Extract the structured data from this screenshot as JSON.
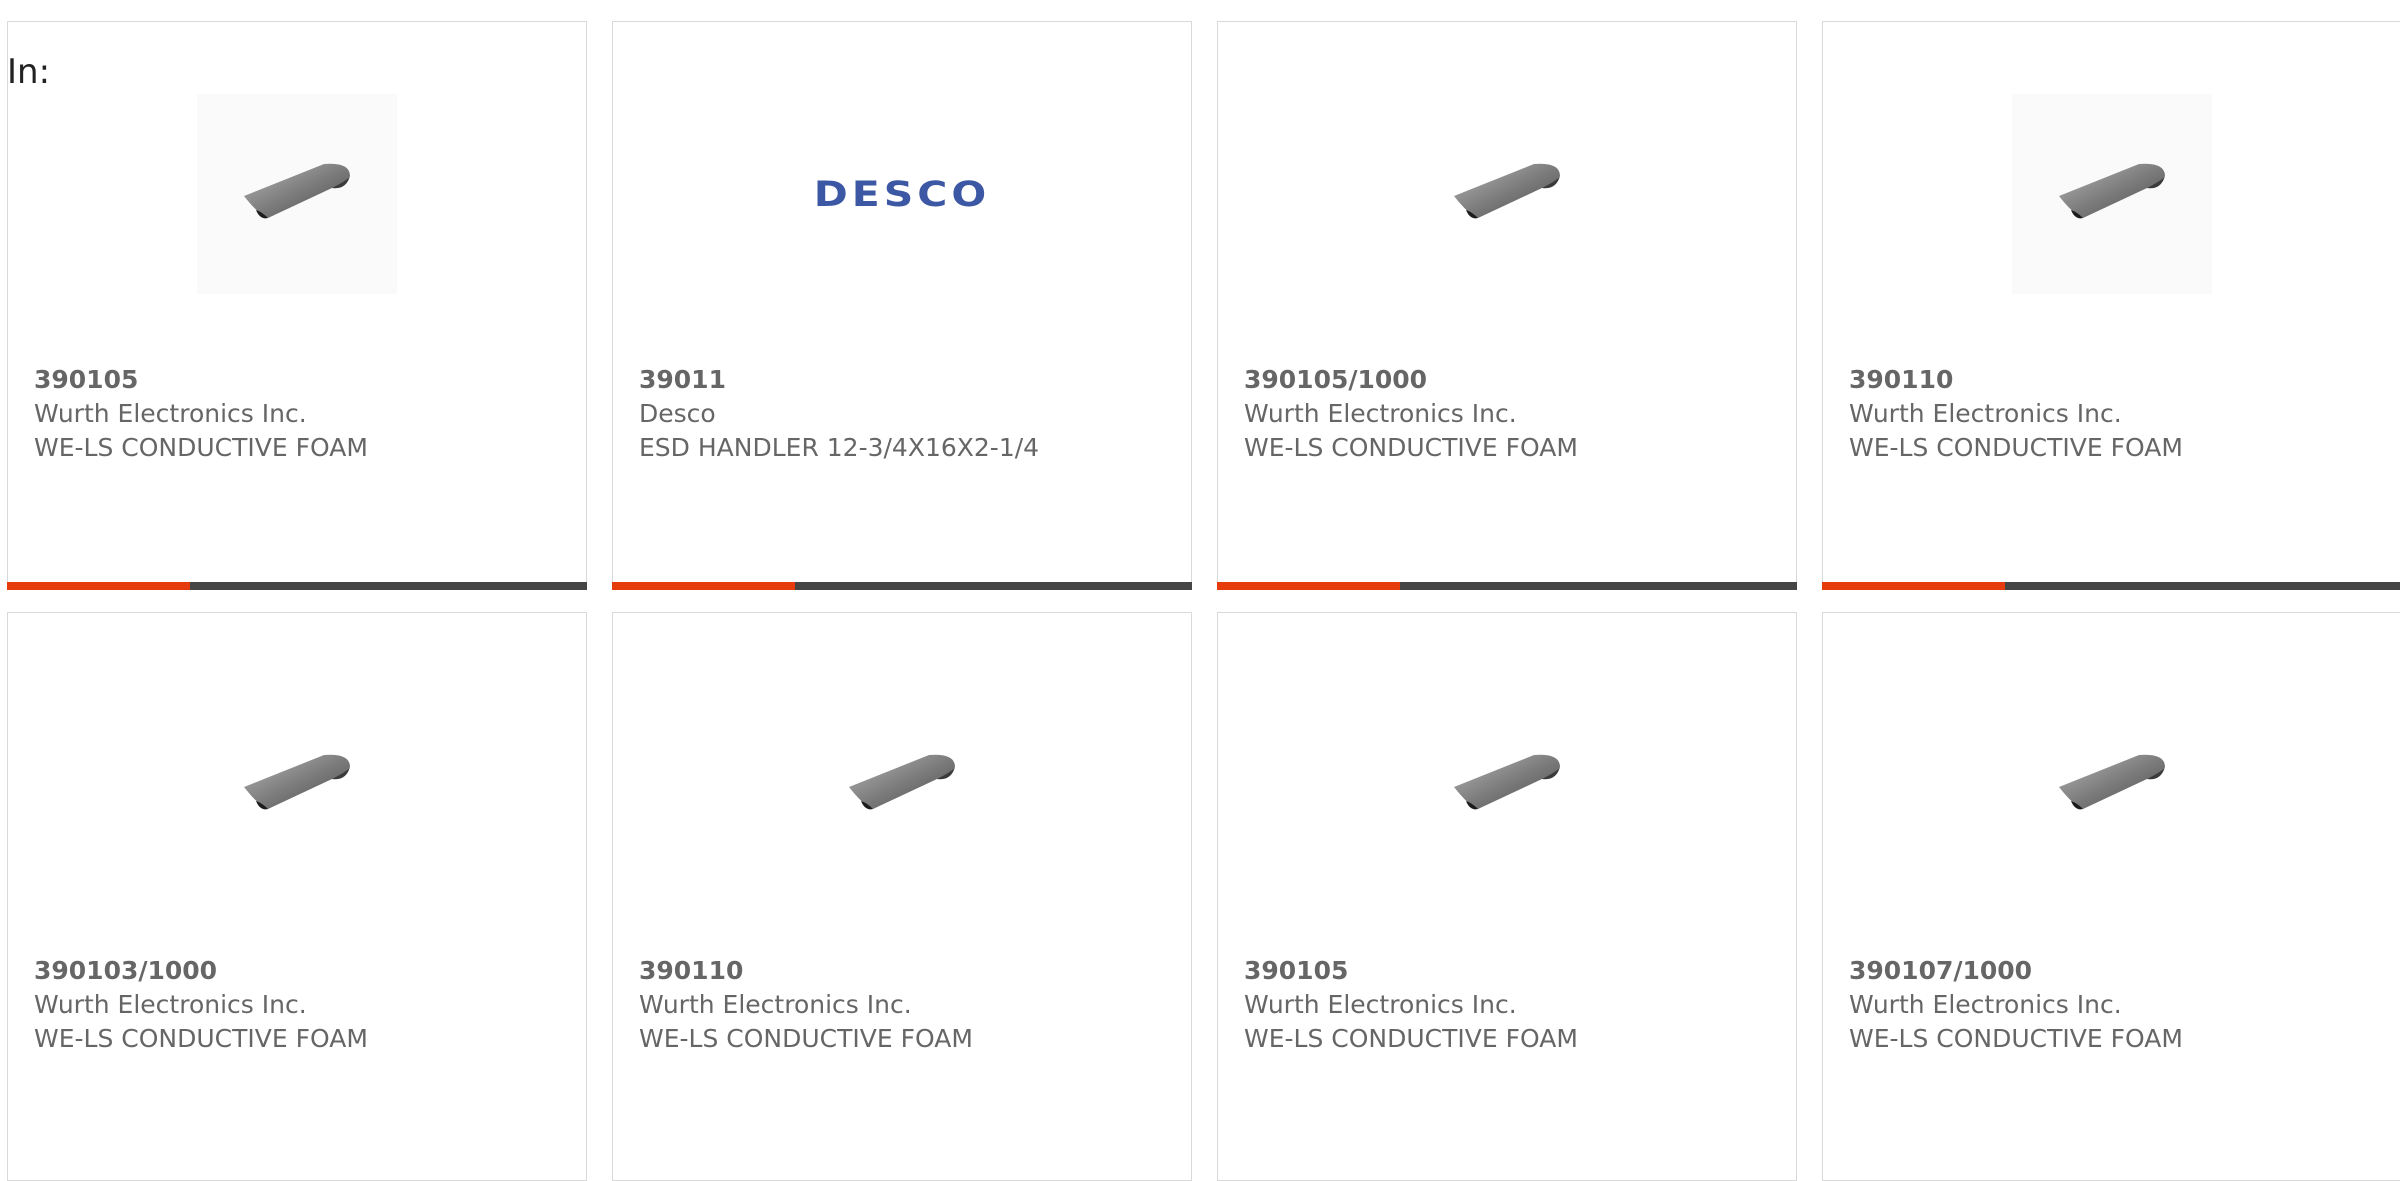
{
  "filter": {
    "label": "In:"
  },
  "products": [
    {
      "part_number": "390105",
      "manufacturer": "Wurth Electronics Inc.",
      "description": "WE-LS CONDUCTIVE FOAM",
      "image": "foam-sheet-icon"
    },
    {
      "part_number": "39011",
      "manufacturer": "Desco",
      "description": "ESD HANDLER 12-3/4X16X2-1/4",
      "image": "desco-logo",
      "logo_text": "DESCO"
    },
    {
      "part_number": "390105/1000",
      "manufacturer": "Wurth Electronics Inc.",
      "description": "WE-LS CONDUCTIVE FOAM",
      "image": "foam-sheet-icon"
    },
    {
      "part_number": "390110",
      "manufacturer": "Wurth Electronics Inc.",
      "description": "WE-LS CONDUCTIVE FOAM",
      "image": "foam-sheet-icon"
    },
    {
      "part_number": "390103/1000",
      "manufacturer": "Wurth Electronics Inc.",
      "description": "WE-LS CONDUCTIVE FOAM",
      "image": "foam-sheet-icon"
    },
    {
      "part_number": "390110",
      "manufacturer": "Wurth Electronics Inc.",
      "description": "WE-LS CONDUCTIVE FOAM",
      "image": "foam-sheet-icon"
    },
    {
      "part_number": "390105",
      "manufacturer": "Wurth Electronics Inc.",
      "description": "WE-LS CONDUCTIVE FOAM",
      "image": "foam-sheet-icon"
    },
    {
      "part_number": "390107/1000",
      "manufacturer": "Wurth Electronics Inc.",
      "description": "WE-LS CONDUCTIVE FOAM",
      "image": "foam-sheet-icon"
    }
  ],
  "colors": {
    "accent": "#e63c0d",
    "bar": "#454545",
    "text": "#666666",
    "logo": "#3c57a3"
  }
}
